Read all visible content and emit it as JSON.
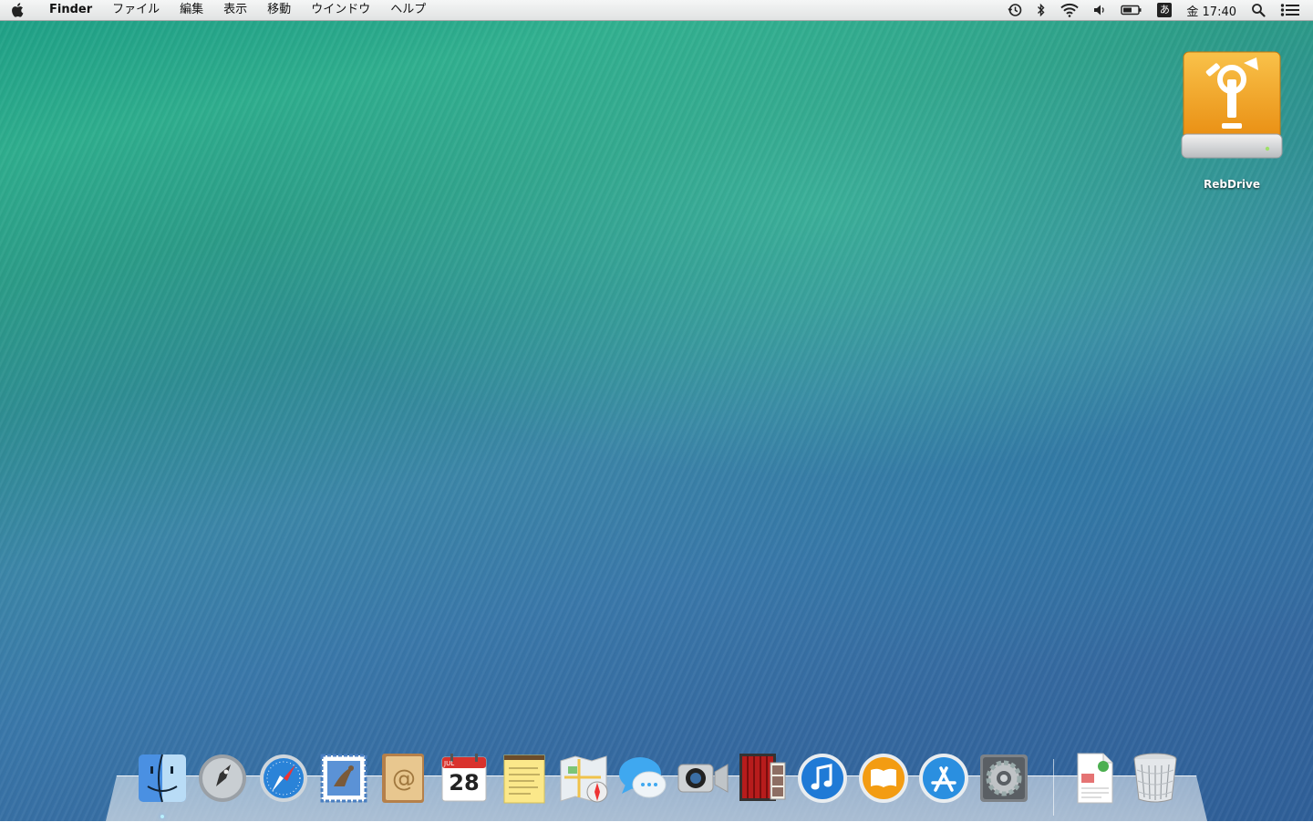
{
  "menubar": {
    "apple_icon": "apple-icon",
    "app_name": "Finder",
    "menus": [
      "ファイル",
      "編集",
      "表示",
      "移動",
      "ウインドウ",
      "ヘルプ"
    ],
    "status_icons": [
      "time-machine-icon",
      "bluetooth-icon",
      "wifi-icon",
      "volume-icon",
      "battery-icon"
    ],
    "input_method": "あ",
    "clock": "金 17:40",
    "spotlight_icon": "search-icon",
    "notification_icon": "notification-center-icon"
  },
  "desktop": {
    "icons": [
      {
        "label": "RebDrive",
        "icon": "firewire-external-drive-icon"
      }
    ]
  },
  "dock": {
    "items": [
      "finder",
      "launchpad",
      "safari",
      "mail",
      "contacts",
      "calendar",
      "notes",
      "maps",
      "messages",
      "facetime",
      "photo-booth",
      "itunes",
      "ibooks",
      "app-store",
      "system-preferences",
      "document-stack",
      "trash"
    ],
    "calendar_month": "JUL",
    "calendar_day": "28",
    "running": [
      "finder"
    ],
    "colors": {
      "finder": "#4a90e2",
      "ibooks": "#f39c12",
      "itunes": "#1f7ad6",
      "appstore": "#2a8fe0",
      "drive": "#f1a21f"
    }
  }
}
